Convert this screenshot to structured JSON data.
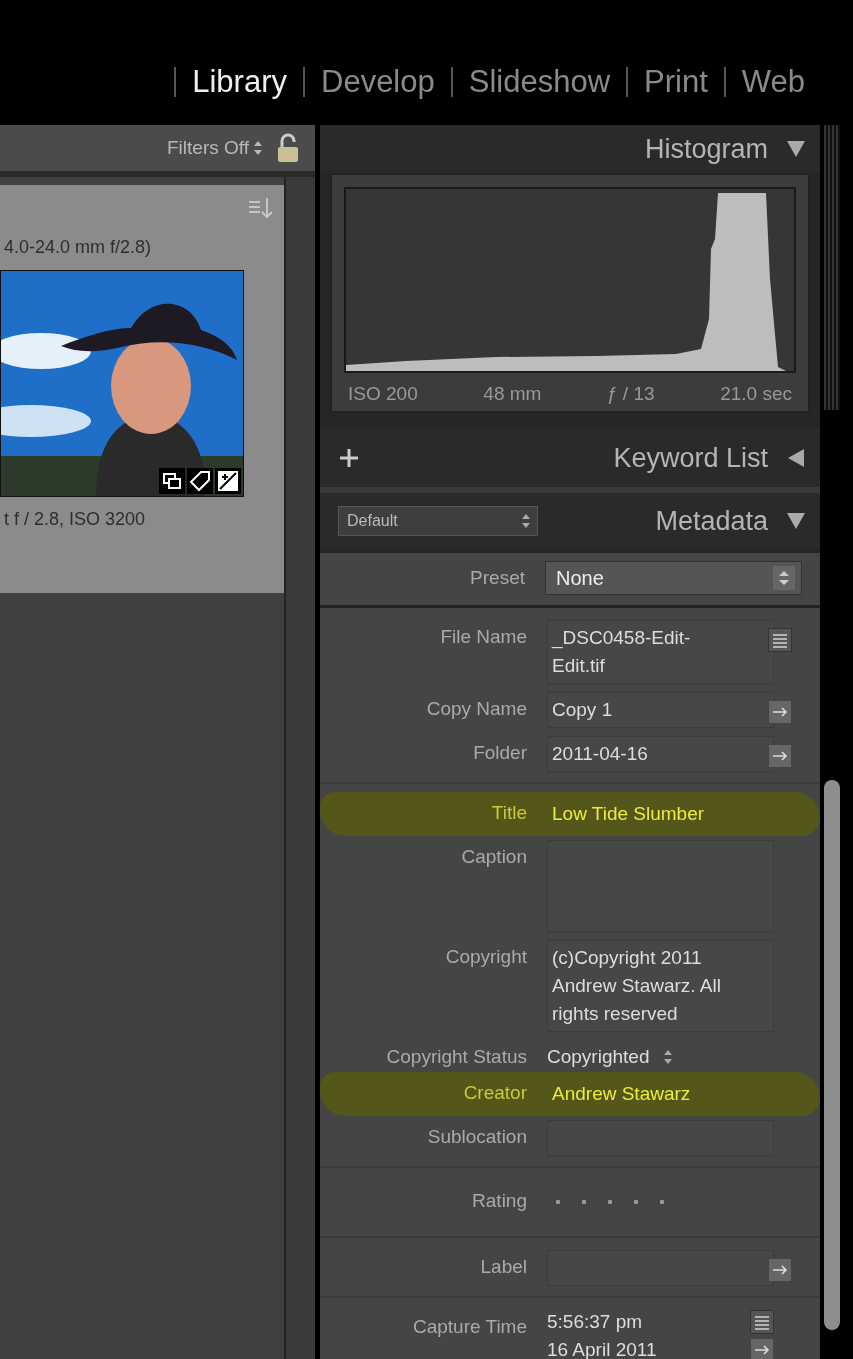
{
  "modules": [
    {
      "label": "Library",
      "selected": true
    },
    {
      "label": "Develop",
      "selected": false
    },
    {
      "label": "Slideshow",
      "selected": false
    },
    {
      "label": "Print",
      "selected": false
    },
    {
      "label": "Web",
      "selected": false
    }
  ],
  "filter_bar": {
    "label": "Filters Off"
  },
  "grid_cell": {
    "lens_text": "4.0-24.0 mm f/2.8)",
    "exposure_text": "t f / 2.8, ISO 3200"
  },
  "histogram": {
    "title": "Histogram",
    "expanded": true,
    "readouts": [
      "ISO 200",
      "48 mm",
      "ƒ / 13",
      "21.0 sec"
    ]
  },
  "keyword_list": {
    "title": "Keyword List",
    "expanded": false
  },
  "metadata": {
    "title": "Metadata",
    "expanded": true,
    "preset_menu": "Default",
    "preset": {
      "label": "Preset",
      "value": "None"
    },
    "groups": [
      [
        {
          "kind": "text",
          "label": "File Name",
          "value": "_DSC0458-Edit-Edit.tif",
          "action": {
            "kind": "list"
          },
          "highlighted": false
        },
        {
          "kind": "text",
          "label": "Copy Name",
          "value": "Copy 1",
          "action": {
            "kind": "arrow"
          },
          "highlighted": false
        },
        {
          "kind": "text",
          "label": "Folder",
          "value": "2011-04-16",
          "action": {
            "kind": "arrow"
          },
          "highlighted": false
        }
      ],
      [
        {
          "kind": "text",
          "label": "Title",
          "value": "Low Tide Slumber",
          "highlighted": true
        },
        {
          "kind": "area",
          "label": "Caption",
          "highlighted": false
        },
        {
          "kind": "area",
          "label": "Copyright",
          "value": "(c)Copyright 2011 Andrew Stawarz. All rights reserved",
          "highlighted": false
        },
        {
          "kind": "select",
          "label": "Copyright Status",
          "value": "Copyrighted",
          "highlighted": false
        },
        {
          "kind": "text",
          "label": "Creator",
          "value": "Andrew Stawarz",
          "highlighted": true
        },
        {
          "kind": "text",
          "label": "Sublocation",
          "highlighted": false
        }
      ],
      [
        {
          "kind": "rating",
          "label": "Rating",
          "stars": 0
        }
      ],
      [
        {
          "kind": "text",
          "label": "Label",
          "action": {
            "kind": "arrow"
          },
          "highlighted": false
        }
      ],
      [
        {
          "kind": "datetime",
          "label": "Capture Time",
          "lines": [
            {
              "value": "5:56:37 pm",
              "action": {
                "kind": "list"
              }
            },
            {
              "value": "16 April 2011",
              "action": {
                "kind": "arrow"
              }
            }
          ]
        }
      ]
    ]
  }
}
